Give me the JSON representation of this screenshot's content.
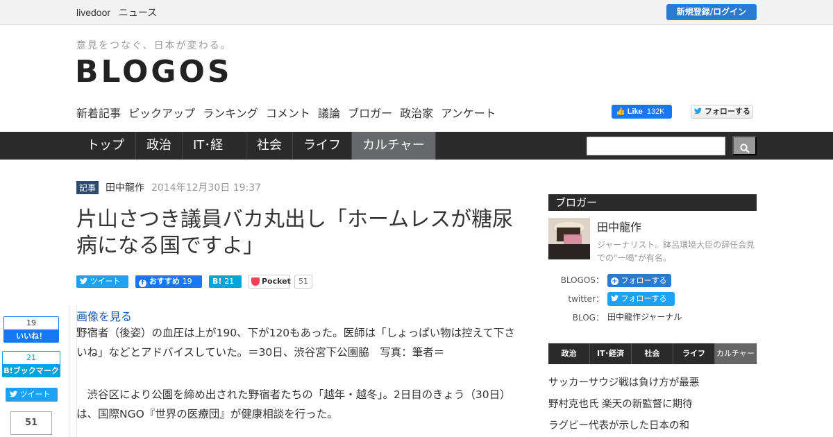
{
  "topbar": {
    "brand_1": "livedoor",
    "brand_2": "ニュース",
    "signup_label": "新規登録/ログイン"
  },
  "header": {
    "tagline": "意見をつなぐ、日本が変わる。",
    "logo": "BLOGOS"
  },
  "subnav": [
    "新着記事",
    "ピックアップ",
    "ランキング",
    "コメント",
    "議論",
    "ブロガー",
    "政治家",
    "アンケート"
  ],
  "social_top": {
    "fb_like_label": "Like",
    "fb_like_count": "132K",
    "tw_follow_label": "フォローする"
  },
  "navbar": {
    "tabs": [
      {
        "label": "トップ"
      },
      {
        "label": "政治"
      },
      {
        "label": "IT･経済"
      },
      {
        "label": "社会"
      },
      {
        "label": "ライフ"
      },
      {
        "label": "カルチャー"
      }
    ],
    "active_tab": "カルチャー"
  },
  "article": {
    "badge": "記事",
    "author": "田中龍作",
    "date": "2014年12月30日 19:37",
    "title": "片山さつき議員バカ丸出し「ホームレスが糖尿病になる国ですよ」",
    "share": {
      "tweet_label": "ツイート",
      "fb_label": "おすすめ",
      "fb_count": "19",
      "hatena_label": "B!",
      "hatena_count": "21",
      "pocket_label": "Pocket",
      "pocket_count": "51"
    },
    "view_image": "画像を見る",
    "caption": "野宿者（後姿）の血圧は上が190、下が120もあった。医師は「しょっぱい物は控えて下さいね」などとアドバイスしていた。＝30日、渋谷宮下公園脇　写真：筆者＝",
    "para1": "　渋谷区により公園を締め出された野宿者たちの「越年・越冬」。2日目のきょう（30日）は、国際NGO『世界の医療団』が健康相談を行った。"
  },
  "float_share": {
    "fb_count": "19",
    "fb_label": "いいね！",
    "hatena_count": "21",
    "hatena_label": "B!ブックマーク",
    "tweet_label": "ツイート",
    "pocket_count": "51"
  },
  "sidebar": {
    "heading": "ブロガー",
    "blogger_name": "田中龍作",
    "blogger_desc": "ジャーナリスト。鉢呂環境大臣の辞任会見での\"一喝\"が有名。",
    "blogos_label": "BLOGOS：",
    "blogos_follow": "フォローする",
    "twitter_label": "twitter：",
    "twitter_follow": "フォローする",
    "blog_label": "BLOG：",
    "blog_name": "田中龍作ジャーナル",
    "tabs": [
      "政治",
      "IT･経済",
      "社会",
      "ライフ",
      "カルチャー"
    ],
    "active_tab": "カルチャー",
    "ranking": [
      "サッカーサウジ戦は負け方が最悪",
      "野村克也氏 楽天の新監督に期待",
      "ラグビー代表が示した日本の和"
    ]
  },
  "colors": {
    "nav_bg": "#2b2b2b",
    "active_tab": "#66686b",
    "accent_blue": "#2b7ad0",
    "twitter": "#1da1f2",
    "facebook": "#1877f2",
    "hatena": "#00a4de"
  }
}
